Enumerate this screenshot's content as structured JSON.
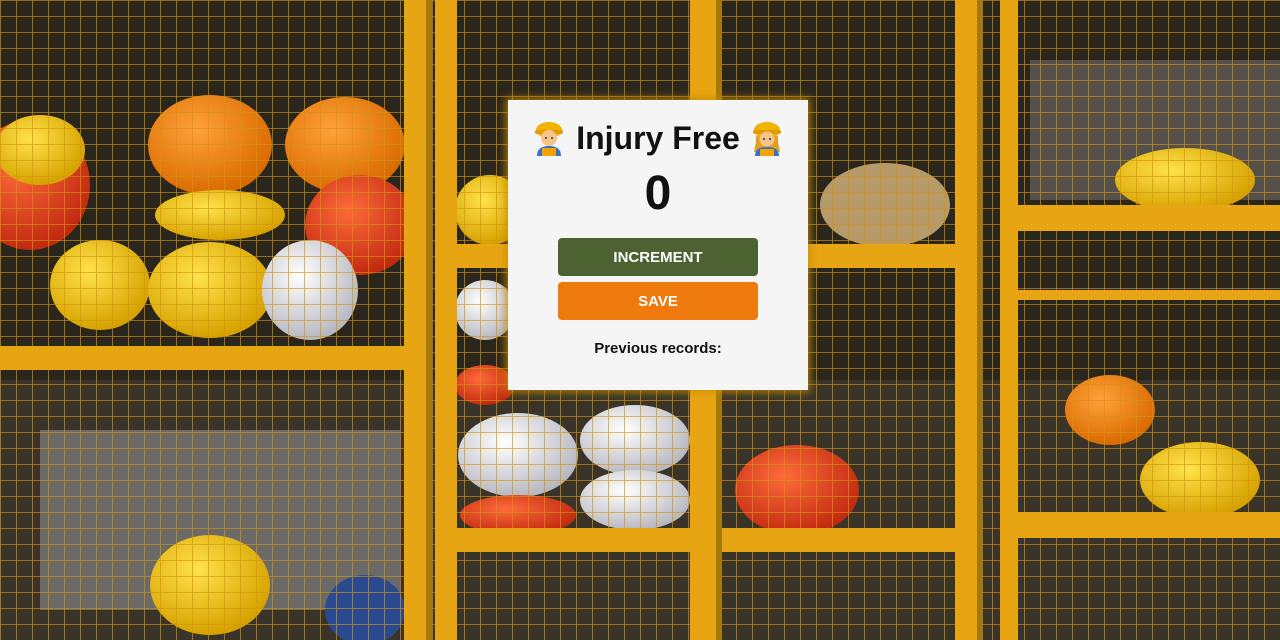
{
  "app": {
    "title": "Injury Free",
    "title_icon_left": "construction-worker-man-emoji",
    "title_icon_right": "construction-worker-woman-emoji"
  },
  "counter": {
    "value": "0"
  },
  "buttons": {
    "increment_label": "INCREMENT",
    "save_label": "SAVE"
  },
  "records": {
    "heading": "Previous records:"
  },
  "colors": {
    "increment_bg": "#4c6331",
    "save_bg": "#ee7a0d",
    "card_bg": "#f5f5f5",
    "card_glow": "#e0a100",
    "cage_yellow": "#e8a513"
  },
  "background": {
    "image": "hard-hats-in-yellow-cages-photo"
  }
}
